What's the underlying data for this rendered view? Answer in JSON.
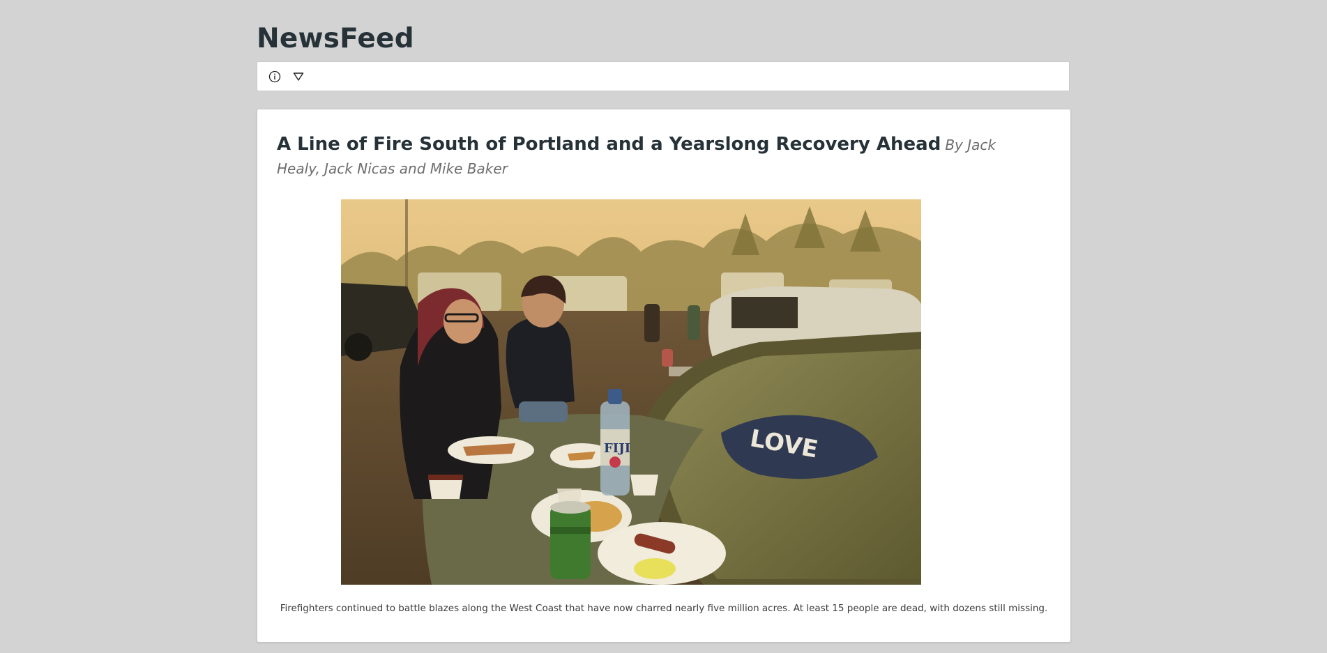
{
  "app": {
    "title": "NewsFeed"
  },
  "toolbar": {
    "info_icon": "info-circle-icon",
    "filter_icon": "triangle-down-icon"
  },
  "article": {
    "headline": "A Line of Fire South of Portland and a Yearslong Recovery Ahead",
    "byline": "By Jack Healy, Jack Nicas and Mike Baker",
    "caption": "Firefighters continued to battle blazes along the West Coast that have now charred nearly five million acres. At least 15 people are dead, with dozens still missing.",
    "bottle_label": "FIJI",
    "window_text": "LOVE"
  },
  "colors": {
    "background": "#d3d3d3",
    "card": "#ffffff",
    "title": "#263238",
    "byline": "#6d6d6d"
  }
}
